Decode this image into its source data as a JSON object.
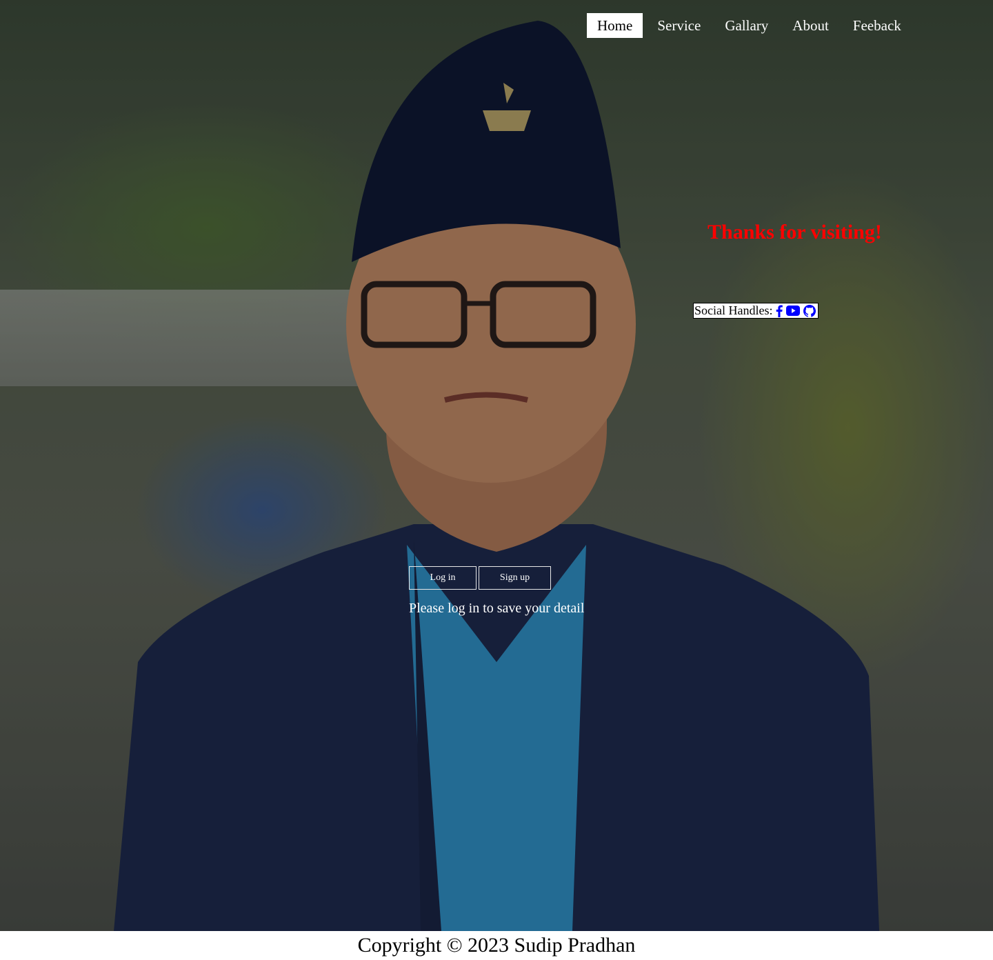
{
  "nav": {
    "items": [
      {
        "label": "Home",
        "active": true
      },
      {
        "label": "Service",
        "active": false
      },
      {
        "label": "Gallary",
        "active": false
      },
      {
        "label": "About",
        "active": false
      },
      {
        "label": "Feeback",
        "active": false
      }
    ]
  },
  "hero": {
    "greeting": "Thanks for visiting!",
    "social": {
      "label": "Social Handles:",
      "icons": [
        "facebook-icon",
        "youtube-icon",
        "github-icon"
      ],
      "icon_color": "#0000ff"
    },
    "auth": {
      "login_label": "Log in",
      "signup_label": "Sign up",
      "message": "Please log in to save your detail"
    }
  },
  "footer": {
    "copyright": "Copyright © 2023 Sudip Pradhan"
  },
  "colors": {
    "greeting": "#ff0000",
    "nav_active_bg": "#ffffff",
    "text_light": "#ffffff"
  }
}
